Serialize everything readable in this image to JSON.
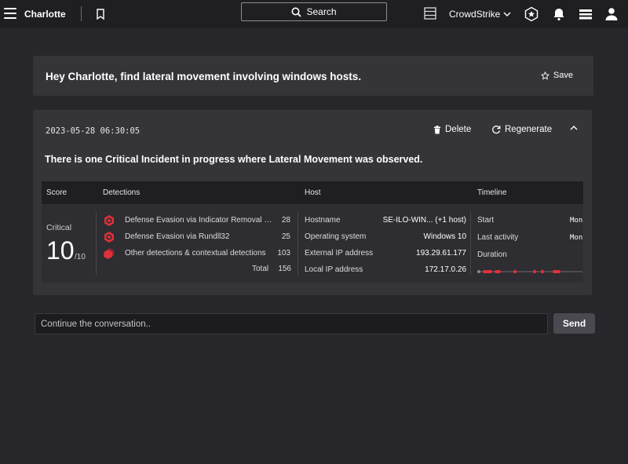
{
  "topbar": {
    "app_title": "Charlotte",
    "search_label": "Search",
    "tenant_name": "CrowdStrike",
    "icons": [
      "hamburger-icon",
      "bookmark-icon",
      "search-icon",
      "layout-icon",
      "chevron-down-icon",
      "badge-icon",
      "bell-icon",
      "switch-icon",
      "user-icon"
    ]
  },
  "prompt": {
    "text": "Hey Charlotte, find lateral movement involving windows hosts.",
    "save_label": "Save"
  },
  "response": {
    "timestamp": "2023-05-28 06:30:05",
    "delete_label": "Delete",
    "regenerate_label": "Regenerate",
    "headline": "There is one Critical Incident in progress where Lateral Movement was observed.",
    "table": {
      "headers": {
        "score": "Score",
        "detections": "Detections",
        "host": "Host",
        "timeline": "Timeline"
      },
      "score": {
        "label": "Critical",
        "value": "10",
        "denominator": "/10"
      },
      "detections": [
        {
          "name": "Defense Evasion via Indicator Removal on Host",
          "count": "28",
          "icon": "hexagon-alert-icon"
        },
        {
          "name": "Defense Evasion via Rundll32",
          "count": "25",
          "icon": "hexagon-alert-icon"
        },
        {
          "name": "Other detections & contextual detections",
          "count": "103",
          "icon": "stacked-hexagon-icon"
        }
      ],
      "total_label": "Total",
      "total_value": "156",
      "host": [
        {
          "key": "Hostname",
          "value": "SE-ILO-WIN... (+1 host)"
        },
        {
          "key": "Operating system",
          "value": "Windows 10"
        },
        {
          "key": "External IP address",
          "value": "193.29.61.177"
        },
        {
          "key": "Local IP address",
          "value": "172.17.0.26"
        }
      ],
      "timeline": [
        {
          "key": "Start",
          "value": "Mon"
        },
        {
          "key": "Last activity",
          "value": "Mon"
        },
        {
          "key": "Duration",
          "value": ""
        }
      ]
    }
  },
  "composer": {
    "placeholder": "Continue the conversation..",
    "send_label": "Send"
  },
  "colors": {
    "background": "#27262a",
    "card": "#353438",
    "critical_red": "#e0303a"
  }
}
